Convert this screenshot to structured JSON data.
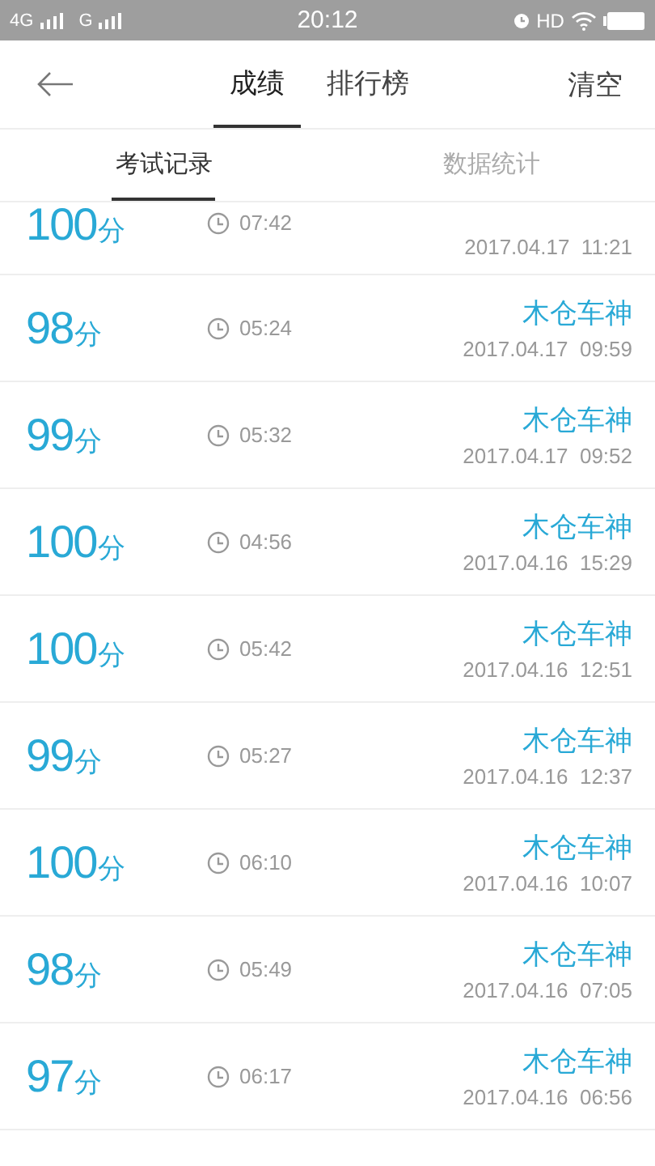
{
  "status_bar": {
    "networks": [
      "4G",
      "G"
    ],
    "time": "20:12",
    "hd": "HD"
  },
  "header": {
    "tabs": [
      {
        "label": "成绩",
        "selected": true
      },
      {
        "label": "排行榜",
        "selected": false
      }
    ],
    "action": "清空"
  },
  "subtabs": [
    {
      "label": "考试记录",
      "selected": true
    },
    {
      "label": "数据统计",
      "selected": false
    }
  ],
  "records": [
    {
      "kind": "partial",
      "score": "100",
      "unit": "分",
      "duration": "07:42",
      "date": "2017.04.17  11:21"
    },
    {
      "kind": "full",
      "score": "98",
      "unit": "分",
      "duration": "05:24",
      "name": "木仓车神",
      "date": "2017.04.17  09:59"
    },
    {
      "kind": "full",
      "score": "99",
      "unit": "分",
      "duration": "05:32",
      "name": "木仓车神",
      "date": "2017.04.17  09:52"
    },
    {
      "kind": "full",
      "score": "100",
      "unit": "分",
      "duration": "04:56",
      "name": "木仓车神",
      "date": "2017.04.16  15:29"
    },
    {
      "kind": "full",
      "score": "100",
      "unit": "分",
      "duration": "05:42",
      "name": "木仓车神",
      "date": "2017.04.16  12:51"
    },
    {
      "kind": "full",
      "score": "99",
      "unit": "分",
      "duration": "05:27",
      "name": "木仓车神",
      "date": "2017.04.16  12:37"
    },
    {
      "kind": "full",
      "score": "100",
      "unit": "分",
      "duration": "06:10",
      "name": "木仓车神",
      "date": "2017.04.16  10:07"
    },
    {
      "kind": "full",
      "score": "98",
      "unit": "分",
      "duration": "05:49",
      "name": "木仓车神",
      "date": "2017.04.16  07:05"
    },
    {
      "kind": "full",
      "score": "97",
      "unit": "分",
      "duration": "06:17",
      "name": "木仓车神",
      "date": "2017.04.16  06:56"
    }
  ]
}
